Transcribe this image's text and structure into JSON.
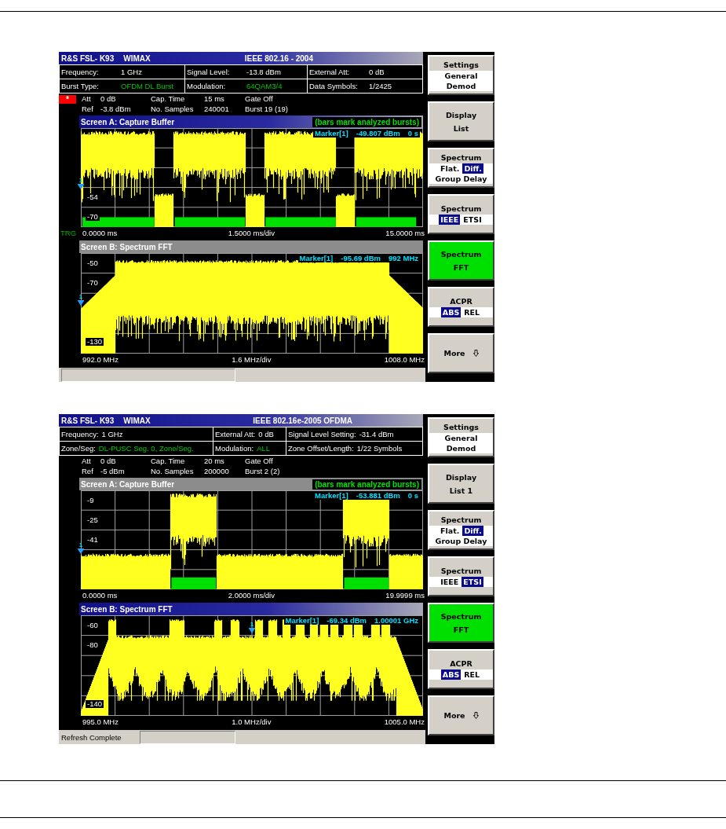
{
  "screens": [
    {
      "instrument": "R&S FSL- K93",
      "application": "WIMAX",
      "standard": "IEEE 802.16 - 2004",
      "info_table": [
        [
          {
            "label": "Frequency:",
            "value": "1 GHz",
            "highlight": false
          },
          {
            "label": "Signal Level:",
            "value": "-13.8 dBm",
            "highlight": false
          },
          {
            "label": "External Att:",
            "value": "0 dB",
            "highlight": false
          }
        ],
        [
          {
            "label": "Burst Type:",
            "value": "OFDM DL Burst",
            "highlight": true
          },
          {
            "label": "Modulation:",
            "value": "64QAM3/4",
            "highlight": true
          },
          {
            "label": "Data Symbols:",
            "value": "1/2425",
            "highlight": false
          }
        ]
      ],
      "status_mark": "*",
      "settings": [
        [
          {
            "label": "Att",
            "value": "0 dB"
          },
          {
            "label": "Cap. Time",
            "value": "15 ms"
          },
          {
            "label": "Gate Off"
          }
        ],
        [
          {
            "label": "Ref",
            "value": "-3.8 dBm"
          },
          {
            "label": "No. Samples",
            "value": "240001"
          },
          {
            "label": "Burst 19 (19)"
          }
        ]
      ],
      "panes": [
        {
          "kind": "capture",
          "title": "Screen A: Capture Buffer",
          "active": true,
          "note": "(bars mark analyzed bursts)",
          "marker_label": "1",
          "marker_readout": [
            "Marker[1]",
            "-49.807 dBm",
            "0 s"
          ],
          "y_ticks": [
            "-54",
            "-70"
          ],
          "x_start": "0.0000 ms",
          "x_scale": "1.5000 ms/div",
          "x_end": "15.0000 ms",
          "trigger_label": "TRG"
        },
        {
          "kind": "spectrum",
          "title": "Screen B: Spectrum FFT",
          "active": false,
          "marker_label": "1",
          "marker_readout": [
            "Marker[1]",
            "-95.69 dBm",
            "992 MHz"
          ],
          "y_ticks": [
            "-50",
            "-70",
            "-130"
          ],
          "x_start": "992.0 MHz",
          "x_scale": "1.6 MHz/div",
          "x_end": "1008.0 MHz"
        }
      ],
      "softkeys": [
        {
          "kind": "options",
          "title": "Settings",
          "option_rows": [
            [
              {
                "label": "General",
                "selected": false
              }
            ],
            [
              {
                "label": "Demod",
                "selected": false
              }
            ]
          ]
        },
        {
          "kind": "plain",
          "lines": [
            "Display",
            "List"
          ],
          "active": false
        },
        {
          "kind": "options",
          "title": "Spectrum",
          "option_rows": [
            [
              {
                "label": "Flat.",
                "selected": false
              },
              {
                "label": "Diff.",
                "selected": true
              }
            ],
            [
              {
                "label": "Group Delay",
                "selected": false
              }
            ]
          ]
        },
        {
          "kind": "options",
          "title": "Spectrum",
          "option_rows": [
            [
              {
                "label": "IEEE",
                "selected": true
              },
              {
                "label": "ETSI",
                "selected": false
              }
            ]
          ]
        },
        {
          "kind": "plain",
          "lines": [
            "Spectrum",
            "FFT"
          ],
          "active": true
        },
        {
          "kind": "options",
          "title": "ACPR",
          "option_rows": [
            [
              {
                "label": "ABS",
                "selected": true
              },
              {
                "label": "REL",
                "selected": false
              }
            ]
          ]
        },
        {
          "kind": "more",
          "label": "More"
        }
      ]
    },
    {
      "instrument": "R&S FSL- K93",
      "application": "WIMAX",
      "standard": "IEEE 802.16e-2005 OFDMA",
      "info_table": [
        [
          {
            "label": "Frequency:",
            "value": "1 GHz",
            "highlight": false
          },
          {
            "label": "External Att:",
            "value": "0 dB",
            "highlight": false
          },
          {
            "label": "Signal Level Setting:",
            "value": "-31.4 dBm",
            "highlight": false
          }
        ],
        [
          {
            "label": "Zone/Seg:",
            "value": "DL-PUSC Seg. 0, Zone/Seg.",
            "highlight": true
          },
          {
            "label": "Modulation:",
            "value": "ALL",
            "highlight": true
          },
          {
            "label": "Zone Offset/Length:",
            "value": "1/22 Symbols",
            "highlight": false
          }
        ]
      ],
      "settings": [
        [
          {
            "label": "Att",
            "value": "0 dB"
          },
          {
            "label": "Cap. Time",
            "value": "20 ms"
          },
          {
            "label": "Gate Off"
          }
        ],
        [
          {
            "label": "Ref",
            "value": "-5 dBm"
          },
          {
            "label": "No. Samples",
            "value": "200000"
          },
          {
            "label": "Burst 2 (2)"
          }
        ]
      ],
      "panes": [
        {
          "kind": "capture",
          "title": "Screen A: Capture Buffer",
          "active": false,
          "note": "(bars mark analyzed bursts)",
          "marker_label": "1",
          "marker_readout": [
            "Marker[1]",
            "-53.881 dBm",
            "0 s"
          ],
          "y_ticks": [
            "-9",
            "-25",
            "-41"
          ],
          "x_start": "0.0000 ms",
          "x_scale": "2.0000 ms/div",
          "x_end": "19.9999 ms"
        },
        {
          "kind": "spectrum",
          "title": "Screen B: Spectrum FFT",
          "active": true,
          "marker_label": "1",
          "marker_readout": [
            "Marker[1]",
            "-69.34 dBm",
            "1.00001 GHz"
          ],
          "y_ticks": [
            "-60",
            "-80",
            "-140"
          ],
          "x_start": "995.0 MHz",
          "x_scale": "1.0 MHz/div",
          "x_end": "1005.0 MHz"
        }
      ],
      "status_text": "Refresh Complete",
      "softkeys": [
        {
          "kind": "options",
          "title": "Settings",
          "option_rows": [
            [
              {
                "label": "General",
                "selected": false
              }
            ],
            [
              {
                "label": "Demod",
                "selected": false
              }
            ]
          ]
        },
        {
          "kind": "plain",
          "lines": [
            "Display",
            "List 1"
          ],
          "active": false
        },
        {
          "kind": "options",
          "title": "Spectrum",
          "option_rows": [
            [
              {
                "label": "Flat.",
                "selected": false
              },
              {
                "label": "Diff.",
                "selected": true
              }
            ],
            [
              {
                "label": "Group Delay",
                "selected": false
              }
            ]
          ]
        },
        {
          "kind": "options",
          "title": "Spectrum",
          "option_rows": [
            [
              {
                "label": "IEEE",
                "selected": false
              },
              {
                "label": "ETSI",
                "selected": true
              }
            ]
          ]
        },
        {
          "kind": "plain",
          "lines": [
            "Spectrum",
            "FFT"
          ],
          "active": true
        },
        {
          "kind": "options",
          "title": "ACPR",
          "option_rows": [
            [
              {
                "label": "ABS",
                "selected": true
              },
              {
                "label": "REL",
                "selected": false
              }
            ]
          ]
        },
        {
          "kind": "more",
          "label": "More"
        }
      ]
    }
  ]
}
